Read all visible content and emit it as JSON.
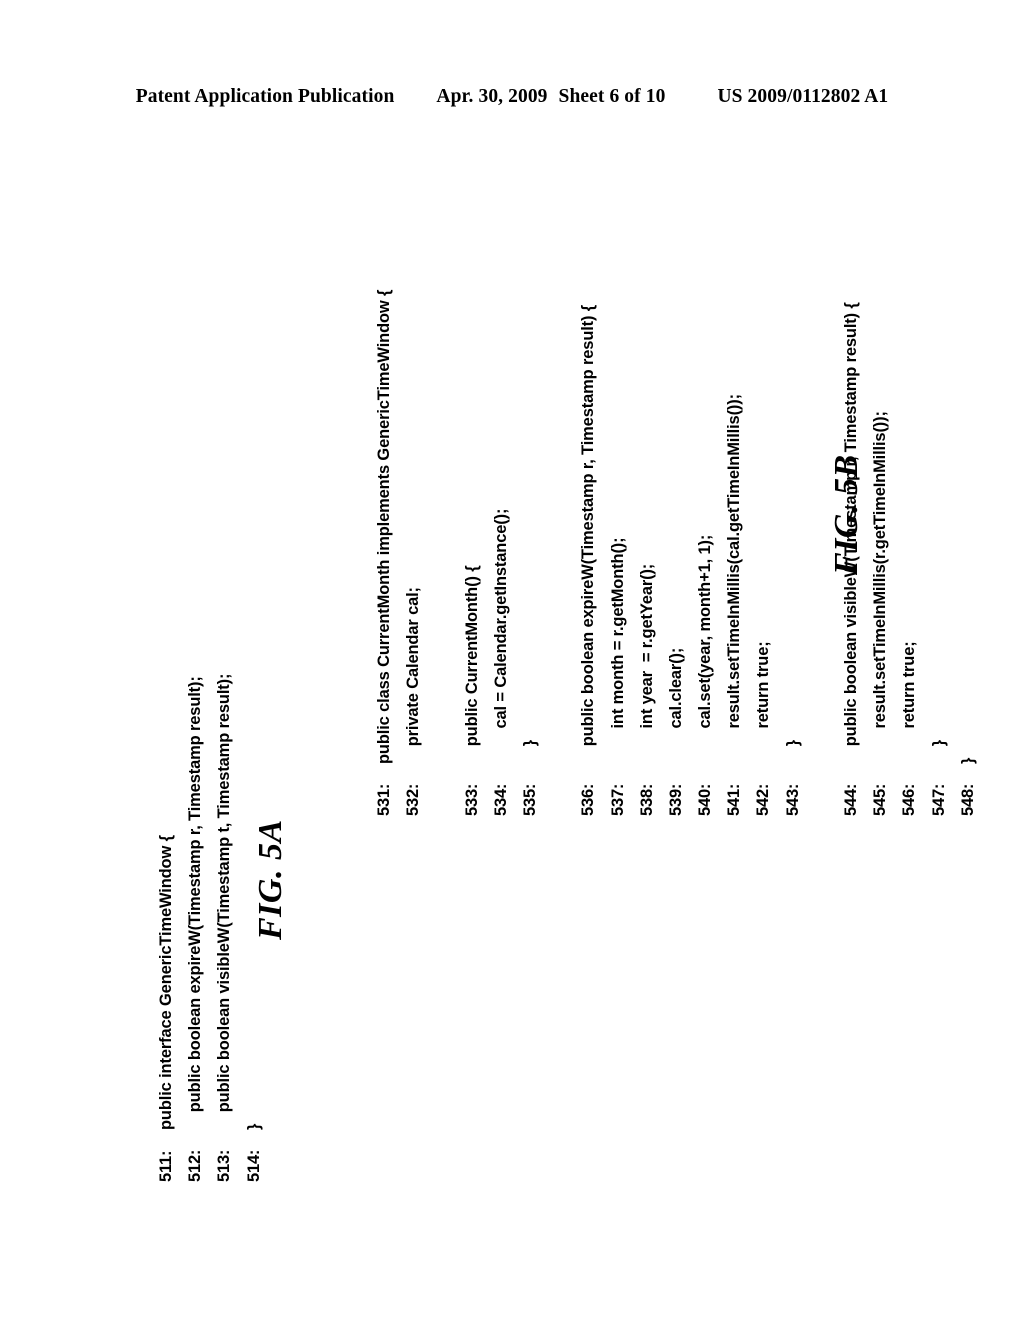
{
  "header": {
    "publication": "Patent Application Publication",
    "date": "Apr. 30, 2009",
    "sheet": "Sheet 6 of 10",
    "patent_number": "US 2009/0112802 A1"
  },
  "figures": [
    {
      "id": "fig5a",
      "label": "FIG. 5A",
      "lines": [
        {
          "number": "511:",
          "text": "public interface GenericTimeWindow {",
          "gap_before": false
        },
        {
          "number": "512:",
          "text": "    public boolean expireW(Timestamp r, Timestamp result);",
          "gap_before": false
        },
        {
          "number": "513:",
          "text": "    public boolean visibleW(Timestamp t, Timestamp result);",
          "gap_before": false
        },
        {
          "number": "514:",
          "text": "}",
          "gap_before": false
        }
      ]
    },
    {
      "id": "fig5b",
      "label": "FIG. 5B",
      "lines": [
        {
          "number": "531:",
          "text": "public class CurrentMonth implements GenericTimeWindow {",
          "gap_before": false
        },
        {
          "number": "532:",
          "text": "    private Calendar cal;",
          "gap_before": false
        },
        {
          "number": "533:",
          "text": "    public CurrentMonth() {",
          "gap_before": true
        },
        {
          "number": "534:",
          "text": "        cal = Calendar.getInstance();",
          "gap_before": false
        },
        {
          "number": "535:",
          "text": "    }",
          "gap_before": false
        },
        {
          "number": "536:",
          "text": "    public boolean expireW(Timestamp r, Timestamp result) {",
          "gap_before": true
        },
        {
          "number": "537:",
          "text": "        int month = r.getMonth();",
          "gap_before": false
        },
        {
          "number": "538:",
          "text": "        int year  = r.getYear();",
          "gap_before": false
        },
        {
          "number": "539:",
          "text": "        cal.clear();",
          "gap_before": false
        },
        {
          "number": "540:",
          "text": "        cal.set(year, month+1, 1);",
          "gap_before": false
        },
        {
          "number": "541:",
          "text": "        result.setTimeInMillis(cal.getTimeInMillis());",
          "gap_before": false
        },
        {
          "number": "542:",
          "text": "        return true;",
          "gap_before": false
        },
        {
          "number": "543:",
          "text": "    }",
          "gap_before": false
        },
        {
          "number": "544:",
          "text": "    public boolean visibleW(Timestamp r, Timestamp result) {",
          "gap_before": true
        },
        {
          "number": "545:",
          "text": "        result.setTimeInMillis(r.getTimeInMillis());",
          "gap_before": false
        },
        {
          "number": "546:",
          "text": "        return true;",
          "gap_before": false
        },
        {
          "number": "547:",
          "text": "    }",
          "gap_before": false
        },
        {
          "number": "548:",
          "text": "}",
          "gap_before": false
        }
      ]
    }
  ]
}
